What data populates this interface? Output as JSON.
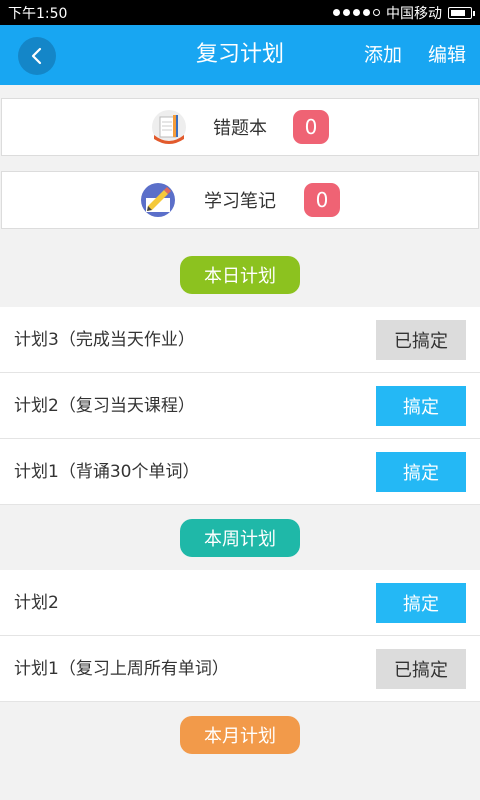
{
  "status": {
    "time": "下午1:50",
    "carrier": "中国移动"
  },
  "header": {
    "back_label": "<",
    "title": "复习计划",
    "add": "添加",
    "edit": "编辑"
  },
  "cards": [
    {
      "label": "错题本",
      "count": "0",
      "icon": "notebook-icon"
    },
    {
      "label": "学习笔记",
      "count": "0",
      "icon": "pencil-note-icon"
    }
  ],
  "sections": {
    "day": {
      "title": "本日计划",
      "color": "#8cc21f"
    },
    "week": {
      "title": "本周计划",
      "color": "#1fb8a8"
    },
    "month": {
      "title": "本月计划",
      "color": "#f29a4a"
    }
  },
  "day_plans": [
    {
      "label": "计划3（完成当天作业）",
      "action": "已搞定",
      "done": true
    },
    {
      "label": "计划2（复习当天课程）",
      "action": "搞定",
      "done": false
    },
    {
      "label": "计划1（背诵30个单词）",
      "action": "搞定",
      "done": false
    }
  ],
  "week_plans": [
    {
      "label": "计划2",
      "action": "搞定",
      "done": false
    },
    {
      "label": "计划1（复习上周所有单词）",
      "action": "已搞定",
      "done": true
    }
  ]
}
